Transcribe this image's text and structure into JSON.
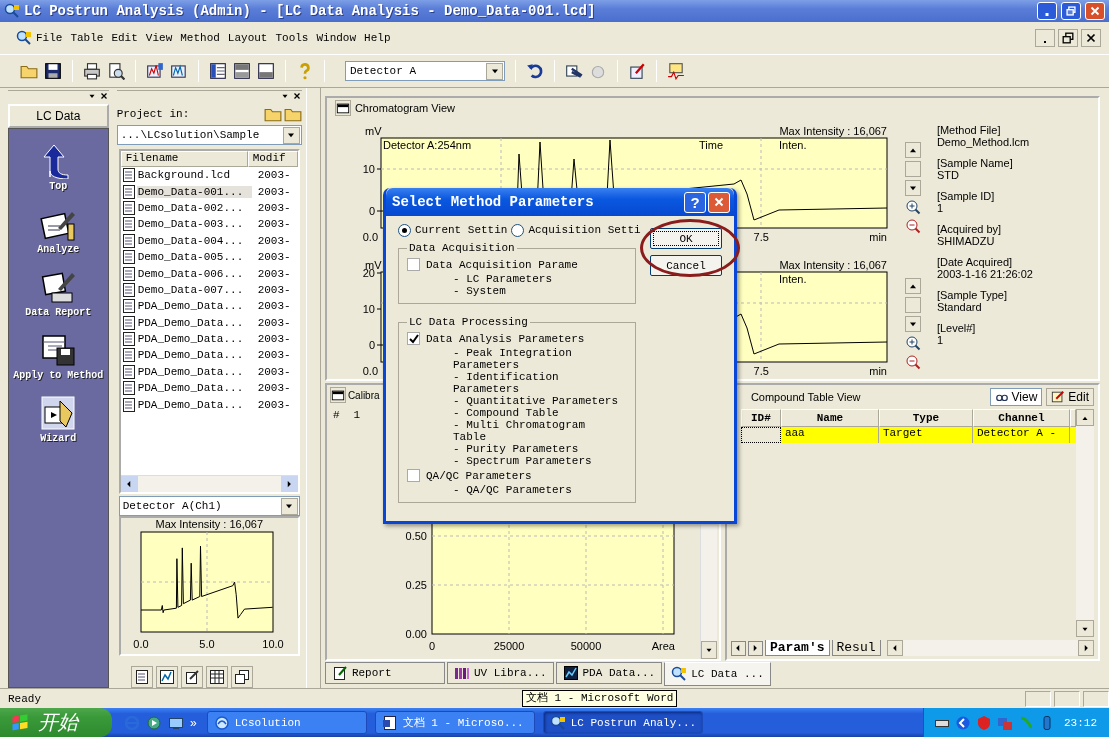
{
  "window": {
    "title": "LC Postrun Analysis (Admin) - [LC Data Analysis - Demo_Data-001.lcd]"
  },
  "menu": [
    "File",
    "Table",
    "Edit",
    "View",
    "Method",
    "Layout",
    "Tools",
    "Window",
    "Help"
  ],
  "toolbar": {
    "detector": "Detector A"
  },
  "nav": {
    "header": "LC Data",
    "items": [
      {
        "label": "Top",
        "kind": "top"
      },
      {
        "label": "Analyze",
        "kind": "analyze"
      },
      {
        "label": "Data Report",
        "kind": "report"
      },
      {
        "label": "Apply to Method",
        "kind": "apply"
      },
      {
        "label": "Wizard",
        "kind": "wizard"
      }
    ]
  },
  "explorer": {
    "project_label": "Project in:",
    "path": "...\\LCsolution\\Sample",
    "columns": [
      "Filename",
      "Modif"
    ],
    "files": [
      {
        "name": "Background.lcd",
        "modified": "2003-",
        "selected": false
      },
      {
        "name": "Demo_Data-001...",
        "modified": "2003-",
        "selected": true
      },
      {
        "name": "Demo_Data-002...",
        "modified": "2003-",
        "selected": false
      },
      {
        "name": "Demo_Data-003...",
        "modified": "2003-",
        "selected": false
      },
      {
        "name": "Demo_Data-004...",
        "modified": "2003-",
        "selected": false
      },
      {
        "name": "Demo_Data-005...",
        "modified": "2003-",
        "selected": false
      },
      {
        "name": "Demo_Data-006...",
        "modified": "2003-",
        "selected": false
      },
      {
        "name": "Demo_Data-007...",
        "modified": "2003-",
        "selected": false
      },
      {
        "name": "PDA_Demo_Data...",
        "modified": "2003-",
        "selected": false
      },
      {
        "name": "PDA_Demo_Data...",
        "modified": "2003-",
        "selected": false
      },
      {
        "name": "PDA_Demo_Data...",
        "modified": "2003-",
        "selected": false
      },
      {
        "name": "PDA_Demo_Data...",
        "modified": "2003-",
        "selected": false
      },
      {
        "name": "PDA_Demo_Data...",
        "modified": "2003-",
        "selected": false
      },
      {
        "name": "PDA_Demo_Data...",
        "modified": "2003-",
        "selected": false
      },
      {
        "name": "PDA_Demo_Data...",
        "modified": "2003-",
        "selected": false
      }
    ],
    "channel": "Detector A(Ch1)",
    "max_intensity": "Max Intensity :  16,067",
    "x_ticks": [
      "0.0",
      "5.0",
      "10.0"
    ]
  },
  "chromatogram_view": {
    "title": "Chromatogram View",
    "charts": [
      {
        "y_unit": "mV",
        "detector": "Detector A:254nm",
        "time_label": "Time",
        "inten_label": "Inten.",
        "max_intensity": "Max Intensity :  16,067",
        "y_ticks": [
          "10",
          "0"
        ],
        "x_ticks": [
          "0.0",
          "7.5"
        ],
        "x_unit": "min"
      },
      {
        "y_unit": "mV",
        "inten_label": "Inten.",
        "max_intensity": "Max Intensity :  16,067",
        "y_ticks": [
          "20",
          "10",
          "0"
        ],
        "x_ticks": [
          "0.0",
          "7.5"
        ],
        "x_unit": "min"
      }
    ],
    "info": [
      {
        "label": "[Method File]",
        "value": "Demo_Method.lcm"
      },
      {
        "label": "[Sample Name]",
        "value": "STD"
      },
      {
        "label": "[Sample ID]",
        "value": "1"
      },
      {
        "label": "[Acquired by]",
        "value": "SHIMADZU"
      },
      {
        "label": "[Date Acquired]",
        "value": "2003-1-16 21:26:02"
      },
      {
        "label": "[Sample Type]",
        "value": "Standard"
      },
      {
        "label": "[Level#]",
        "value": "1"
      }
    ]
  },
  "calibration_view": {
    "title": "Calibra",
    "index_label": "#",
    "index": "1",
    "y_ticks": [
      "0.50",
      "0.25",
      "0.00"
    ],
    "x_ticks": [
      "0",
      "25000",
      "50000"
    ],
    "x_unit": "Area"
  },
  "compound_table": {
    "title": "Compound Table View",
    "buttons": [
      "View",
      "Edit"
    ],
    "columns": [
      "ID#",
      "Name",
      "Type",
      "Channel"
    ],
    "rows": [
      {
        "name": "aaa",
        "type": "Target",
        "channel": "Detector A -",
        "selected": true
      }
    ],
    "sheet_tabs": [
      {
        "label": "Param's",
        "selected": true
      },
      {
        "label": "Resul",
        "selected": false
      }
    ]
  },
  "document_tabs": [
    {
      "label": "Report",
      "kind": "report",
      "selected": false
    },
    {
      "label": "UV Libra...",
      "kind": "library",
      "selected": false
    },
    {
      "label": "PDA Data...",
      "kind": "pda",
      "selected": false
    },
    {
      "label": "LC Data ...",
      "kind": "lc",
      "selected": true
    }
  ],
  "status_bar": {
    "text": "Ready"
  },
  "tooltip": "文档 1 - Microsoft Word",
  "taskbar": {
    "start": "开始",
    "more": "»",
    "tasks": [
      {
        "label": "LCsolution",
        "kind": "lc",
        "selected": false
      },
      {
        "label": "文档 1 - Microso...",
        "kind": "word",
        "selected": false
      },
      {
        "label": "LC Postrun Analy...",
        "kind": "app",
        "selected": true
      }
    ],
    "clock": "23:12"
  },
  "dialog": {
    "title": "Select Method Parameters",
    "help": "?",
    "modes": [
      {
        "label": "Current Settin",
        "selected": true
      },
      {
        "label": "Acquisition Setti",
        "selected": false
      }
    ],
    "groups": [
      {
        "title": "Data Acquisition",
        "options": [
          {
            "label": "Data Acquisition Parame",
            "checked": false,
            "items": [
              "- LC Parameters",
              "- System"
            ]
          }
        ]
      },
      {
        "title": "LC Data Processing",
        "options": [
          {
            "label": "Data Analysis Parameters",
            "checked": true,
            "items": [
              "- Peak Integration Parameters",
              "- Identification Parameters",
              "- Quantitative Parameters",
              "- Compound Table",
              "- Multi Chromatogram Table",
              "- Purity Parameters",
              "- Spectrum Parameters"
            ]
          },
          {
            "label": "QA/QC Parameters",
            "checked": false,
            "items": [
              "- QA/QC Parameters"
            ]
          }
        ]
      }
    ],
    "buttons": [
      "OK",
      "Cancel"
    ]
  }
}
